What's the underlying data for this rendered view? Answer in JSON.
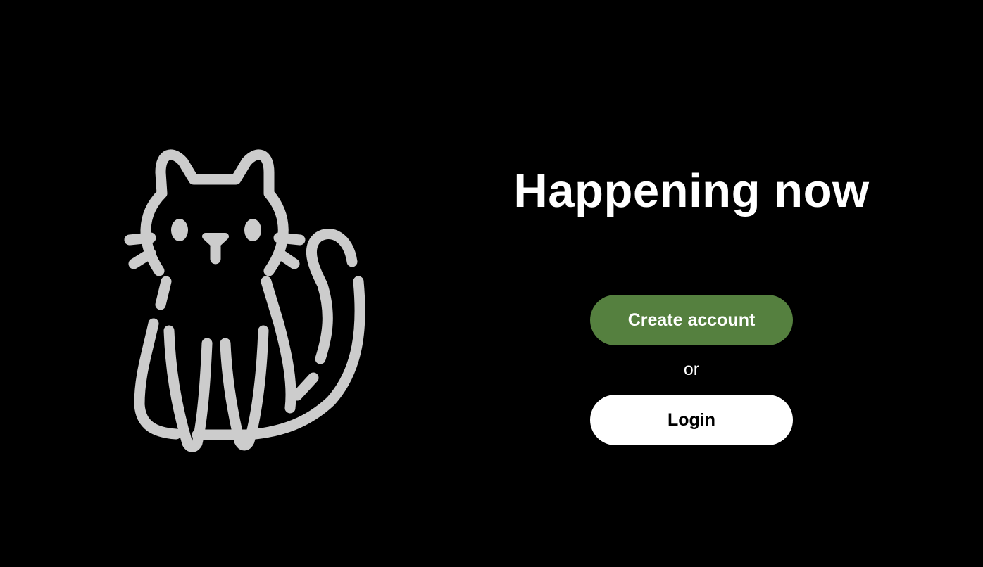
{
  "colors": {
    "background": "#000000",
    "logo_stroke": "#cccccc",
    "accent": "#55803f",
    "text": "#ffffff",
    "login_bg": "#ffffff",
    "login_text": "#000000"
  },
  "logo": {
    "icon": "cat-icon"
  },
  "hero": {
    "headline": "Happening now"
  },
  "auth": {
    "create_account_label": "Create account",
    "separator": "or",
    "login_label": "Login"
  }
}
